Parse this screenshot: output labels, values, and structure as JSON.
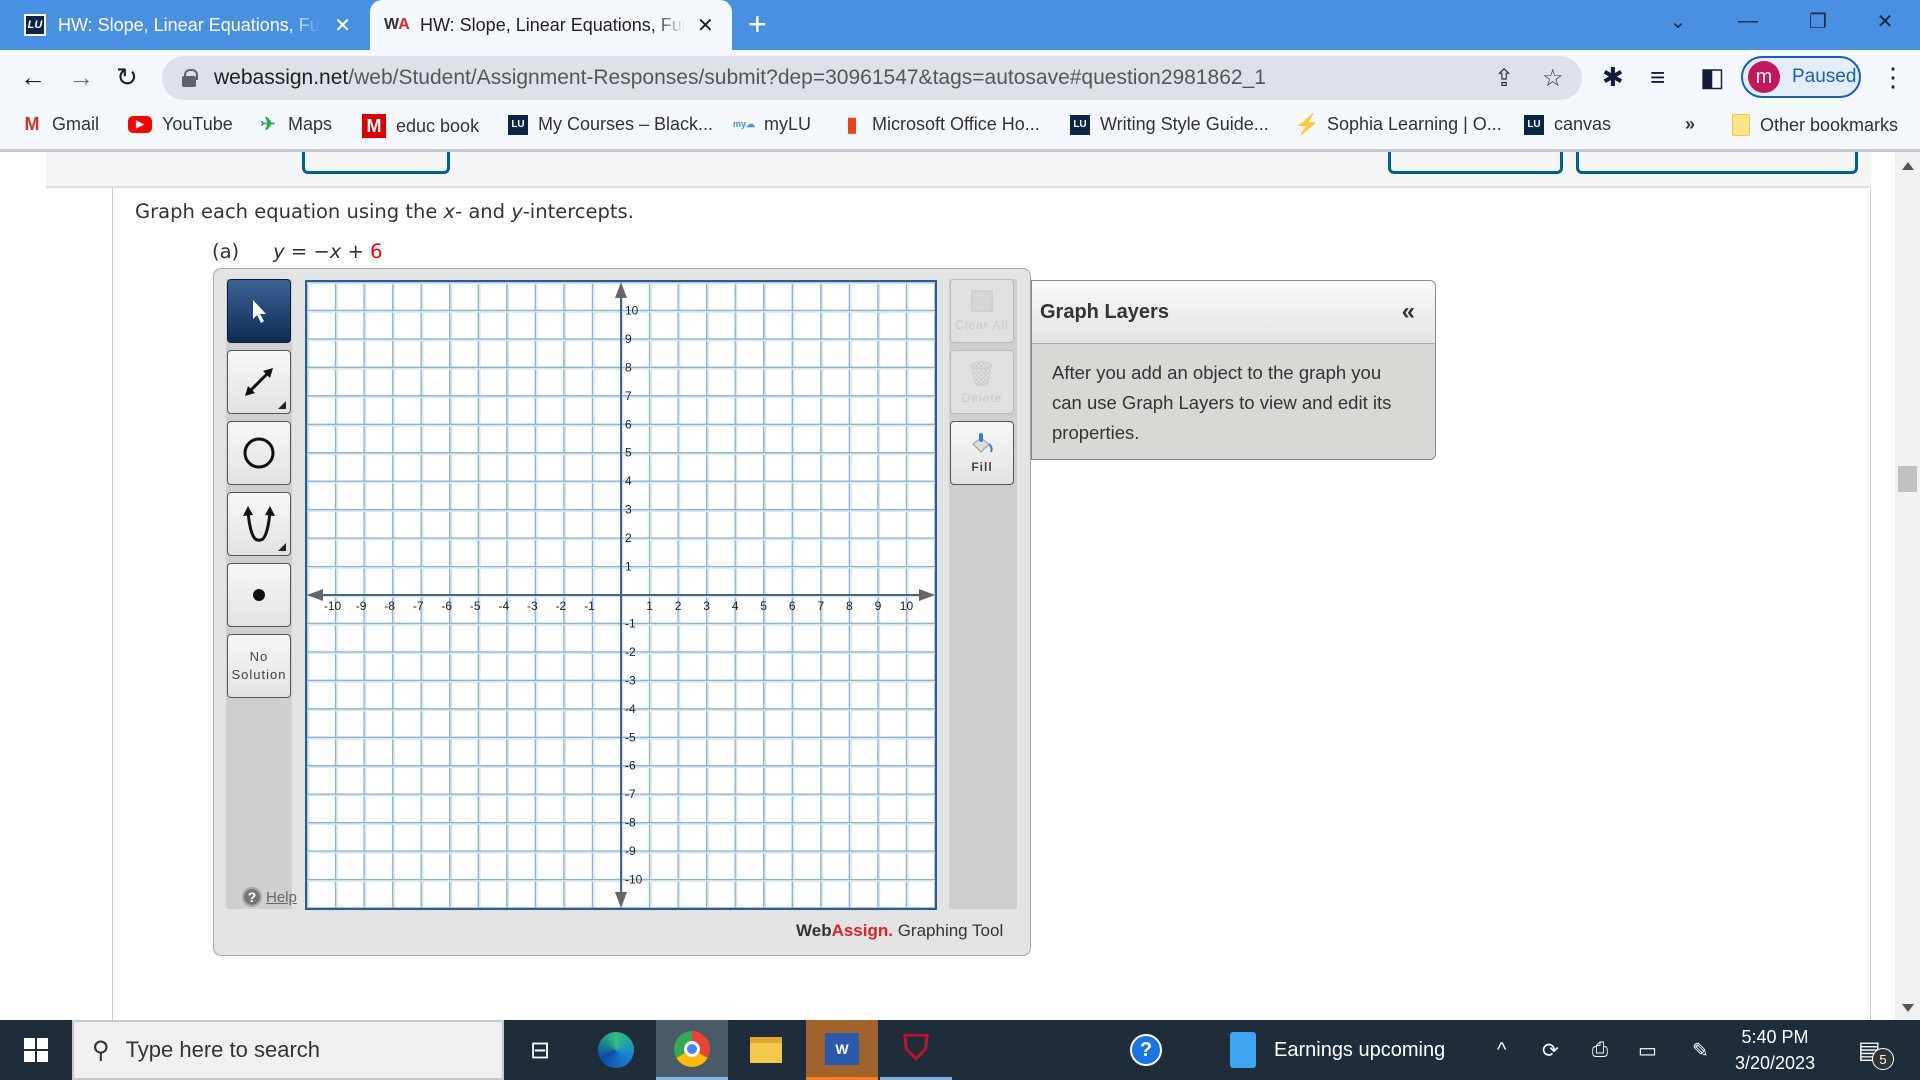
{
  "browser": {
    "tabs": [
      {
        "title": "HW: Slope, Linear Equations, Functions",
        "favicon": "lu-icon",
        "active": false
      },
      {
        "title": "HW: Slope, Linear Equations, Functions",
        "favicon": "webassign-icon",
        "active": true
      }
    ],
    "new_tab": "+",
    "url_host": "webassign.net",
    "url_path": "/web/Student/Assignment-Responses/submit?dep=30961547&tags=autosave#question2981862_1",
    "profile_initial": "m",
    "profile_status": "Paused",
    "bookmarks": [
      {
        "label": "Gmail",
        "icon": "gmail-icon"
      },
      {
        "label": "YouTube",
        "icon": "youtube-icon"
      },
      {
        "label": "Maps",
        "icon": "maps-icon"
      },
      {
        "label": "educ book",
        "icon": "m-icon"
      },
      {
        "label": "My Courses – Black...",
        "icon": "lu-icon"
      },
      {
        "label": "myLU",
        "icon": "mylu-icon"
      },
      {
        "label": "Microsoft Office Ho...",
        "icon": "office-icon"
      },
      {
        "label": "Writing Style Guide...",
        "icon": "lu-icon"
      },
      {
        "label": "Sophia Learning | O...",
        "icon": "sophia-icon"
      },
      {
        "label": "canvas",
        "icon": "lu-icon"
      }
    ],
    "more_bookmarks": "»",
    "other_bookmarks": "Other bookmarks"
  },
  "question": {
    "prompt_pre": "Graph each equation using the ",
    "x_var": "x",
    "prompt_mid": "- and ",
    "y_var": "y",
    "prompt_post": "-intercepts.",
    "part_label": "(a)",
    "equation_main": "y = −x + ",
    "equation_const": "6"
  },
  "graph_tool": {
    "tools": [
      {
        "name": "select",
        "selected": true
      },
      {
        "name": "line",
        "selected": false
      },
      {
        "name": "circle",
        "selected": false
      },
      {
        "name": "parabola",
        "selected": false
      },
      {
        "name": "point",
        "selected": false
      }
    ],
    "no_solution_1": "No",
    "no_solution_2": "Solution",
    "help": "Help",
    "clear_all": "Clear All",
    "delete": "Delete",
    "fill": "Fill",
    "brand_web": "Web",
    "brand_assign": "Assign.",
    "brand_suffix": " Graphing Tool",
    "axis": {
      "xmin": -11,
      "xmax": 11,
      "ymin": -11,
      "ymax": 11,
      "label_min": -10,
      "label_max": 10
    }
  },
  "layers": {
    "title": "Graph Layers",
    "collapse": "«",
    "body": "After you add an object to the graph you can use Graph Layers to view and edit its properties."
  },
  "taskbar": {
    "search_placeholder": "Type here to search",
    "news": "Earnings upcoming",
    "time": "5:40 PM",
    "date": "3/20/2023",
    "notifications": "5"
  }
}
